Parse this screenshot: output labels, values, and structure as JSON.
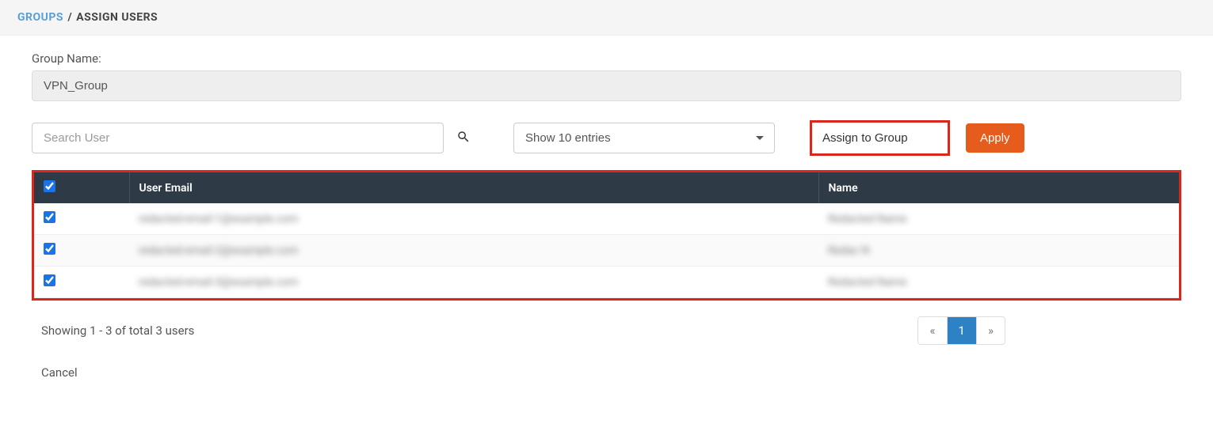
{
  "breadcrumb": {
    "root": "GROUPS",
    "separator": "/",
    "current": "ASSIGN USERS"
  },
  "form": {
    "group_name_label": "Group Name:",
    "group_name_value": "VPN_Group"
  },
  "controls": {
    "search_placeholder": "Search User",
    "entries_selected": "Show 10 entries",
    "assign_selected": "Assign to Group",
    "apply_label": "Apply"
  },
  "table": {
    "select_all_checked": true,
    "headers": {
      "email": "User Email",
      "name": "Name"
    },
    "rows": [
      {
        "checked": true,
        "email": "redacted-email-1@example.com",
        "name": "Redacted Name"
      },
      {
        "checked": true,
        "email": "redacted-email-2@example.com",
        "name": "Redac N"
      },
      {
        "checked": true,
        "email": "redacted-email-3@example.com",
        "name": "Redacted Name"
      }
    ]
  },
  "footer": {
    "showing_text": "Showing 1 - 3 of total 3 users",
    "pages": {
      "prev": "«",
      "current": "1",
      "next": "»"
    },
    "cancel_label": "Cancel"
  }
}
